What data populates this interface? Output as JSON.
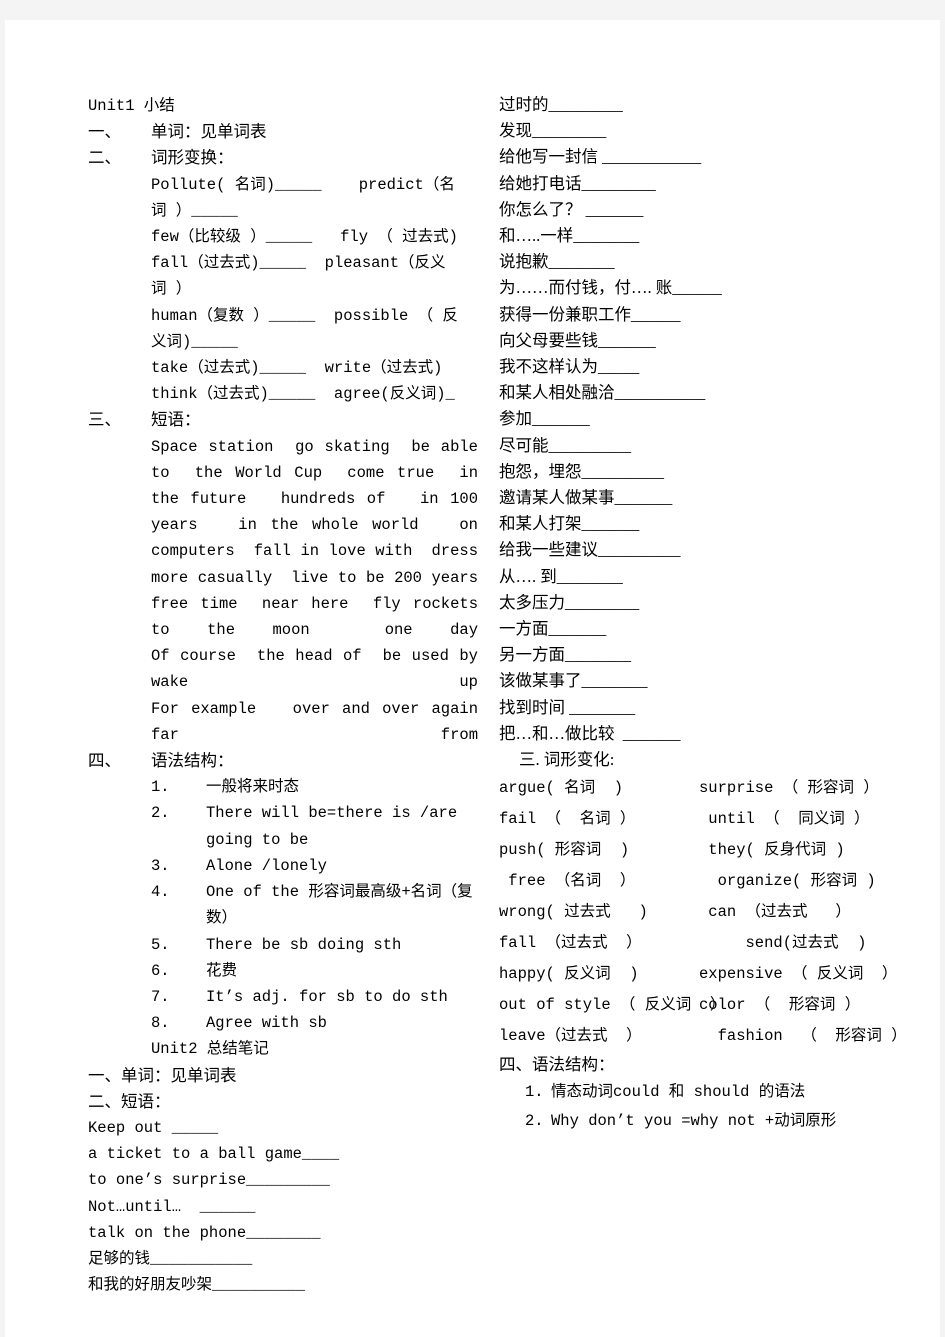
{
  "document": {
    "type": "study-notes",
    "language": "zh-CN + en",
    "page_bg": "#ffffff",
    "canvas_bg": "#f4f4f4",
    "text_color": "#000000"
  },
  "left_column": {
    "title": "Unit1 小结",
    "section_1": {
      "marker": "一、",
      "heading": "单词：见单词表"
    },
    "section_2": {
      "marker": "二、",
      "heading": "词形变换：",
      "lines": [
        "Pollute( 名词)_____    predict（名",
        "词 ）_____",
        "few（比较级 ）_____   fly （ 过去式)",
        "fall（过去式)_____  pleasant（反义",
        "词 ）",
        "human（复数 ）_____  possible （ 反",
        "义词)_____",
        "take（过去式)_____  write（过去式)",
        "think（过去式)_____  agree(反义词)_"
      ]
    },
    "section_3": {
      "marker": "三、",
      "heading": "短语：",
      "paragraphs": [
        "Space station  go skating  be able to  the World Cup  come true  in the future   hundreds of   in 100 years   in the whole world   on computers  fall in love with  dress more casually  live to be 200 years  free time  near here  fly rockets to the moon  one day",
        "Of course  the head of  be used by  wake up",
        "For example   over and over again  far from"
      ]
    },
    "section_4": {
      "marker": "四、",
      "heading": "语法结构：",
      "items": [
        {
          "num": "1.",
          "text": "一般将来时态"
        },
        {
          "num": "2.",
          "text": "There will be=there is /are going to be"
        },
        {
          "num": "3.",
          "text": "Alone /lonely"
        },
        {
          "num": "4.",
          "text": "One of the 形容词最高级+名词（复数）"
        },
        {
          "num": "5.",
          "text": "There be sb doing sth"
        },
        {
          "num": "6.",
          "text": "花费"
        },
        {
          "num": "7.",
          "text": "It’s adj. for sb to do sth"
        },
        {
          "num": "8.",
          "text": "Agree with sb"
        }
      ]
    },
    "unit2_title": "Unit2 总结笔记",
    "unit2_section_1": "一、单词：见单词表",
    "unit2_section_2_heading": "二、短语：",
    "unit2_phrases": [
      "Keep out _____",
      "a ticket to a ball game____",
      "to one’s surprise_________",
      "Not…until…  ______",
      "talk on the phone________",
      "足够的钱___________",
      "和我的好朋友吵架__________"
    ]
  },
  "right_column": {
    "translation_items": [
      "过时的_________",
      "发现_________",
      "给他写一封信 ____________",
      "给她打电话_________",
      "你怎么了？ _______",
      "和…..一样________",
      "说抱歉________",
      "为……而付钱，付…. 账______",
      "获得一份兼职工作______",
      "向父母要些钱_______",
      "我不这样认为_____",
      "和某人相处融洽___________",
      "参加_______",
      "尽可能__________",
      "抱怨，埋怨__________",
      "邀请某人做某事_______",
      "和某人打架_______",
      "给我一些建议__________",
      "从…. 到________",
      "太多压力_________",
      "一方面_______",
      "另一方面________",
      "该做某事了________",
      "找到时间 ________",
      "把…和…做比较  _______"
    ],
    "section_3_heading": "三. 词形变化:",
    "word_forms": [
      {
        "left": "argue( 名词  )",
        "right": "surprise （ 形容词 ）"
      },
      {
        "left": "fail （  名词 ）",
        "right": " until （  同义词 ）"
      },
      {
        "left": "push( 形容词  )",
        "right": " they( 反身代词 )"
      },
      {
        "left": " free （名词  ）",
        "right": "  organize( 形容词 )"
      },
      {
        "left": "wrong( 过去式   )",
        "right": " can （过去式   ）"
      },
      {
        "left": "fall （过去式  ）",
        "right": "     send(过去式  )"
      },
      {
        "left": "happy( 反义词  )",
        "right": "expensive （ 反义词  ）"
      },
      {
        "left": "out of style （ 反义词  ）",
        "right": "color （  形容词 ）"
      },
      {
        "left": "leave（过去式  ）",
        "right": "  fashion  （  形容词 ）"
      }
    ],
    "section_4_heading": "四、语法结构：",
    "grammar_items": [
      {
        "num": "1.",
        "text": "情态动词could 和 should 的语法"
      },
      {
        "num": "2.",
        "text": "Why don’t you =why not +动词原形"
      }
    ]
  }
}
